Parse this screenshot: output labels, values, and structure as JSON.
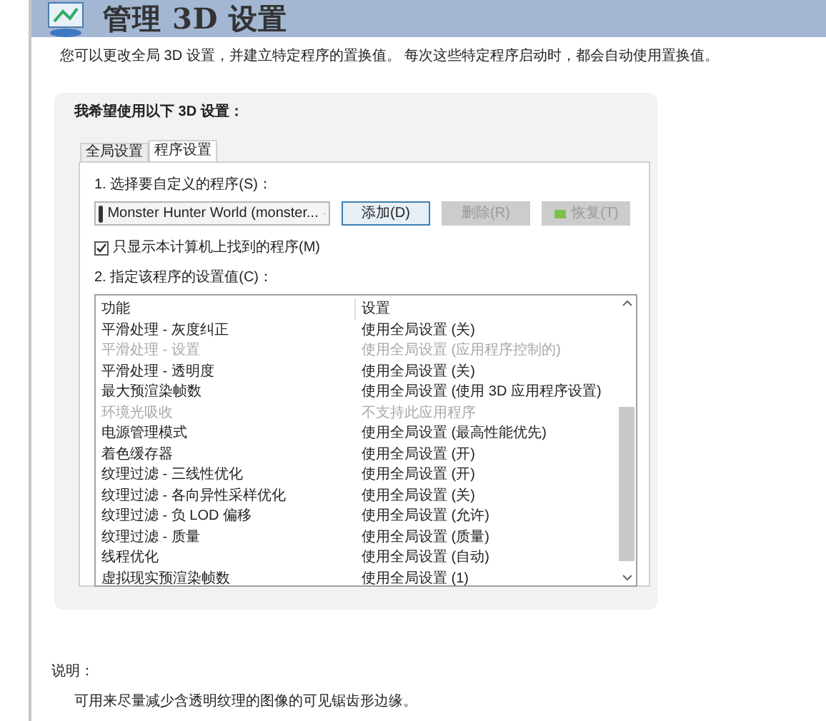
{
  "header": {
    "title": "管理 3D 设置"
  },
  "description": "您可以更改全局 3D 设置，并建立特定程序的置换值。 每次这些特定程序启动时，都会自动使用置换值。",
  "panel": {
    "heading": "我希望使用以下 3D 设置：",
    "tabs": [
      {
        "label": "全局设置",
        "selected": false
      },
      {
        "label": "程序设置",
        "selected": true
      }
    ],
    "program_label": "1. 选择要自定义的程序(S)：",
    "program_dropdown": {
      "value": "Monster Hunter World (monster..."
    },
    "buttons": [
      {
        "label": "添加(D)",
        "disabled": false,
        "kind": "plain"
      },
      {
        "label": "删除(R)",
        "disabled": true,
        "kind": "plain"
      },
      {
        "label": "恢复(T)",
        "disabled": true,
        "kind": "icon"
      }
    ],
    "only_local": {
      "label": "只显示本计算机上找到的程序(M)",
      "checked": true
    },
    "settings_label": "2. 指定该程序的设置值(C)：",
    "table": {
      "columns": [
        "功能",
        "设置"
      ],
      "rows": [
        {
          "feature": "平滑处理 - 灰度纠正",
          "setting": "使用全局设置 (关)",
          "disabled": false
        },
        {
          "feature": "平滑处理 - 设置",
          "setting": "使用全局设置 (应用程序控制的)",
          "disabled": true
        },
        {
          "feature": "平滑处理 - 透明度",
          "setting": "使用全局设置 (关)",
          "disabled": false
        },
        {
          "feature": "最大预渲染帧数",
          "setting": "使用全局设置 (使用 3D 应用程序设置)",
          "disabled": false
        },
        {
          "feature": "环境光吸收",
          "setting": "不支持此应用程序",
          "disabled": true
        },
        {
          "feature": "电源管理模式",
          "setting": "使用全局设置 (最高性能优先)",
          "disabled": false
        },
        {
          "feature": "着色缓存器",
          "setting": "使用全局设置 (开)",
          "disabled": false
        },
        {
          "feature": "纹理过滤 - 三线性优化",
          "setting": "使用全局设置 (开)",
          "disabled": false
        },
        {
          "feature": "纹理过滤 - 各向异性采样优化",
          "setting": "使用全局设置 (关)",
          "disabled": false
        },
        {
          "feature": "纹理过滤 - 负 LOD 偏移",
          "setting": "使用全局设置 (允许)",
          "disabled": false
        },
        {
          "feature": "纹理过滤 - 质量",
          "setting": "使用全局设置 (质量)",
          "disabled": false
        },
        {
          "feature": "线程优化",
          "setting": "使用全局设置 (自动)",
          "disabled": false
        },
        {
          "feature": "虚拟现实预渲染帧数",
          "setting": "使用全局设置 (1)",
          "disabled": false
        }
      ]
    }
  },
  "explanation": {
    "label": "说明：",
    "text": "可用来尽量减少含透明纹理的图像的可见锯齿形边缘。"
  }
}
